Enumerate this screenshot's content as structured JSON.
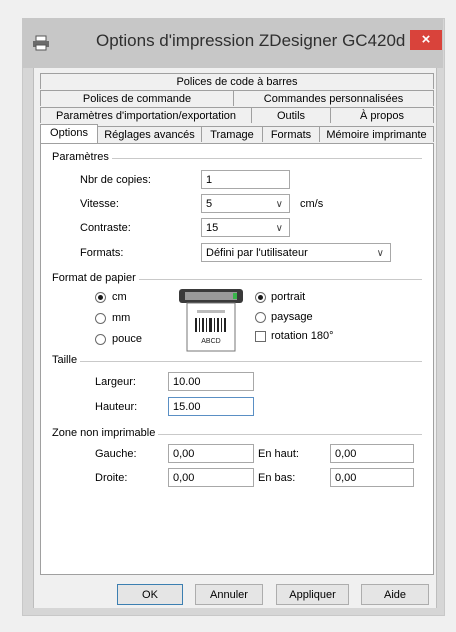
{
  "window": {
    "title": "Options d'impression ZDesigner GC420d",
    "close_glyph": "×",
    "icon": "printer-icon"
  },
  "tabs": {
    "row1": [
      "Polices de code à barres"
    ],
    "row2": [
      "Polices de commande",
      "Commandes personnalisées"
    ],
    "row3": [
      "Paramètres d'importation/exportation",
      "Outils",
      "À propos"
    ],
    "row4": [
      "Options",
      "Réglages avancés",
      "Tramage",
      "Formats",
      "Mémoire imprimante"
    ],
    "active": "Options"
  },
  "parametres": {
    "group_label": "Paramètres",
    "copies_label": "Nbr de copies:",
    "copies_value": "1",
    "vitesse_label": "Vitesse:",
    "vitesse_value": "5",
    "vitesse_unit": "cm/s",
    "contraste_label": "Contraste:",
    "contraste_value": "15",
    "formats_label": "Formats:",
    "formats_value": "Défini par l'utilisateur"
  },
  "format_papier": {
    "group_label": "Format de papier",
    "units": [
      {
        "label": "cm",
        "checked": true
      },
      {
        "label": "mm",
        "checked": false
      },
      {
        "label": "pouce",
        "checked": false
      }
    ],
    "orientation": [
      {
        "label": "portrait",
        "checked": true
      },
      {
        "label": "paysage",
        "checked": false
      }
    ],
    "rotation_label": "rotation 180°",
    "rotation_checked": false,
    "label_image_text": "ABCD"
  },
  "taille": {
    "group_label": "Taille",
    "largeur_label": "Largeur:",
    "largeur_value": "10.00",
    "hauteur_label": "Hauteur:",
    "hauteur_value": "15.00"
  },
  "zone": {
    "group_label": "Zone non imprimable",
    "gauche_label": "Gauche:",
    "gauche_value": "0,00",
    "droite_label": "Droite:",
    "droite_value": "0,00",
    "haut_label": "En haut:",
    "haut_value": "0,00",
    "bas_label": "En bas:",
    "bas_value": "0,00"
  },
  "buttons": {
    "ok": "OK",
    "annuler": "Annuler",
    "appliquer": "Appliquer",
    "aide": "Aide"
  },
  "colors": {
    "close": "#d9433b",
    "titlebar": "#c7c7c7"
  }
}
